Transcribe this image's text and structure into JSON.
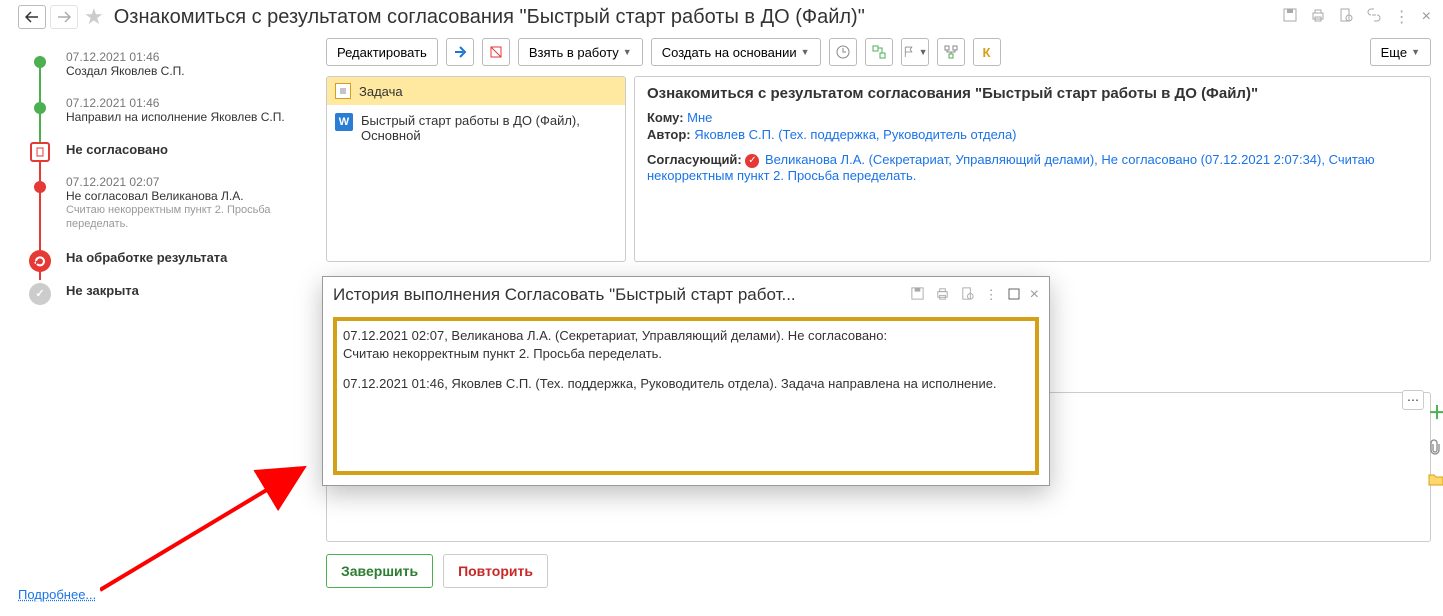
{
  "header": {
    "title": "Ознакомиться с результатом согласования \"Быстрый старт работы в ДО (Файл)\""
  },
  "more_btn": "Еще",
  "timeline": [
    {
      "time": "07.12.2021 01:46",
      "text": "Создал Яковлев С.П.",
      "dot": "green"
    },
    {
      "time": "07.12.2021 01:46",
      "text": "Направил на исполнение Яковлев С.П.",
      "dot": "green"
    },
    {
      "strong": "Не согласовано",
      "dot": "red-sq"
    },
    {
      "time": "07.12.2021 02:07",
      "text": "Не согласовал Великанова Л.А.",
      "note": "Считаю некорректным пункт 2. Просьба переделать.",
      "dot": "red"
    },
    {
      "strong": "На обработке результата",
      "dot": "red-arrow"
    },
    {
      "strong": "Не закрыта",
      "dot": "gray-check"
    }
  ],
  "more_link": "Подробнее...",
  "toolbar": {
    "edit": "Редактировать",
    "take": "Взять в работу",
    "create_based": "Создать на основании",
    "k": "К"
  },
  "task": {
    "label": "Задача",
    "file": "Быстрый старт работы в ДО (Файл), Основной"
  },
  "details": {
    "title": "Ознакомиться с результатом согласования \"Быстрый старт работы в ДО (Файл)\"",
    "to_label": "Кому:",
    "to_value": "Мне",
    "author_label": "Автор:",
    "author_value": "Яковлев С.П. (Тех. поддержка, Руководитель отдела)",
    "approver_label": "Согласующий:",
    "approver_value": "Великанова Л.А. (Секретариат, Управляющий делами), Не согласовано (07.12.2021 2:07:34), Считаю некорректным пункт 2. Просьба переделать."
  },
  "actions": {
    "complete": "Завершить",
    "repeat": "Повторить"
  },
  "dialog": {
    "title": "История выполнения Согласовать \"Быстрый старт работ...",
    "entry1": "07.12.2021 02:07, Великанова Л.А. (Секретариат, Управляющий делами). Не согласовано:",
    "entry1b": "Считаю некорректным пункт 2. Просьба переделать.",
    "entry2": "07.12.2021 01:46, Яковлев С.П. (Тех. поддержка, Руководитель отдела). Задача направлена на исполнение."
  }
}
